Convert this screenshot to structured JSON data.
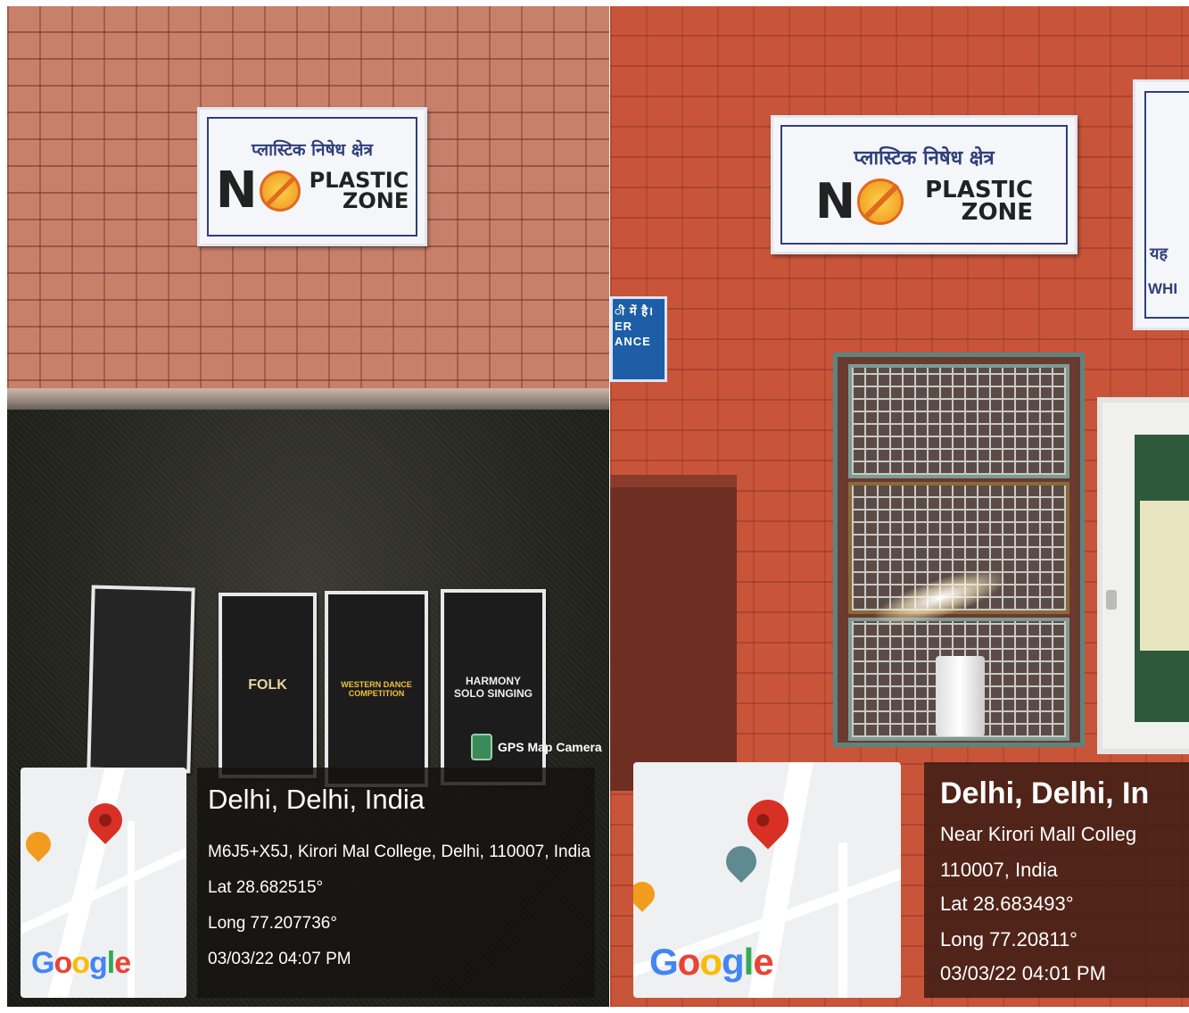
{
  "left_photo": {
    "sign": {
      "hindi": "प्लास्टिक निषेध क्षेत्र",
      "no": "N",
      "plastic": "PLASTIC",
      "zone": "ZONE"
    },
    "posters": [
      {
        "text": ""
      },
      {
        "text": "FOLK"
      },
      {
        "text": "WESTERN DANCE COMPETITION"
      },
      {
        "text": "HARMONY SOLO SINGING"
      }
    ],
    "gps_camera_label": "GPS Map Camera",
    "google_logo": [
      "G",
      "o",
      "o",
      "g",
      "l",
      "e"
    ],
    "location": {
      "title": "Delhi, Delhi, India",
      "address": "M6J5+X5J, Kirori Mal College, Delhi, 110007, India",
      "lat": "Lat 28.682515°",
      "long": "Long 77.207736°",
      "datetime": "03/03/22 04:07 PM"
    }
  },
  "right_photo": {
    "sign": {
      "hindi": "प्लास्टिक निषेध क्षेत्र",
      "no": "N",
      "plastic": "PLASTIC",
      "zone": "ZONE"
    },
    "blue_sign": {
      "line1": "ी में है।",
      "line2": "ER",
      "line3": "ANCE"
    },
    "far_sign": {
      "line1": "यह",
      "line2": "WHI"
    },
    "google_logo": [
      "G",
      "o",
      "o",
      "g",
      "l",
      "e"
    ],
    "location": {
      "title": "Delhi, Delhi, In",
      "address1": "Near Kirori Mall Colleg",
      "address2": "110007, India",
      "lat": "Lat 28.683493°",
      "long": "Long 77.20811°",
      "datetime": "03/03/22 04:01 PM"
    }
  },
  "colors": {
    "google": [
      "#4285F4",
      "#EA4335",
      "#FBBC05",
      "#4285F4",
      "#34A853",
      "#EA4335"
    ],
    "sign_border": "#2f3f7a",
    "pin": "#d93025"
  }
}
